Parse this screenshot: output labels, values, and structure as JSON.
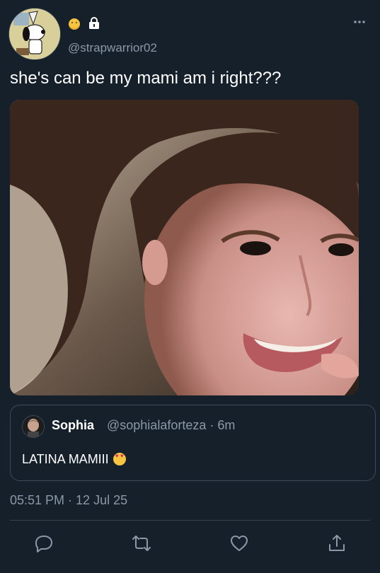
{
  "tweet": {
    "handle": "@strapwarrior02",
    "text": "she's can be my mami am i right???",
    "timestamp": "05:51 PM · 12 Jul 25",
    "icons": {
      "status_emoji": "pensive-face-emoji",
      "locked": "lock-icon",
      "more": "more-horizontal-icon"
    },
    "media": {
      "description_icon": "photo-image"
    }
  },
  "quote": {
    "name": "Sophia",
    "handle_time": "@sophialaforteza · 6m",
    "text": "LATINA MAMIII",
    "emoji": "smiling-face-with-heart-eyes"
  },
  "actions": {
    "reply": "reply-icon",
    "retweet": "retweet-icon",
    "like": "like-icon",
    "share": "share-icon"
  },
  "colors": {
    "background": "#15202b",
    "secondary_text": "#8b98a5",
    "border": "#38444d"
  }
}
